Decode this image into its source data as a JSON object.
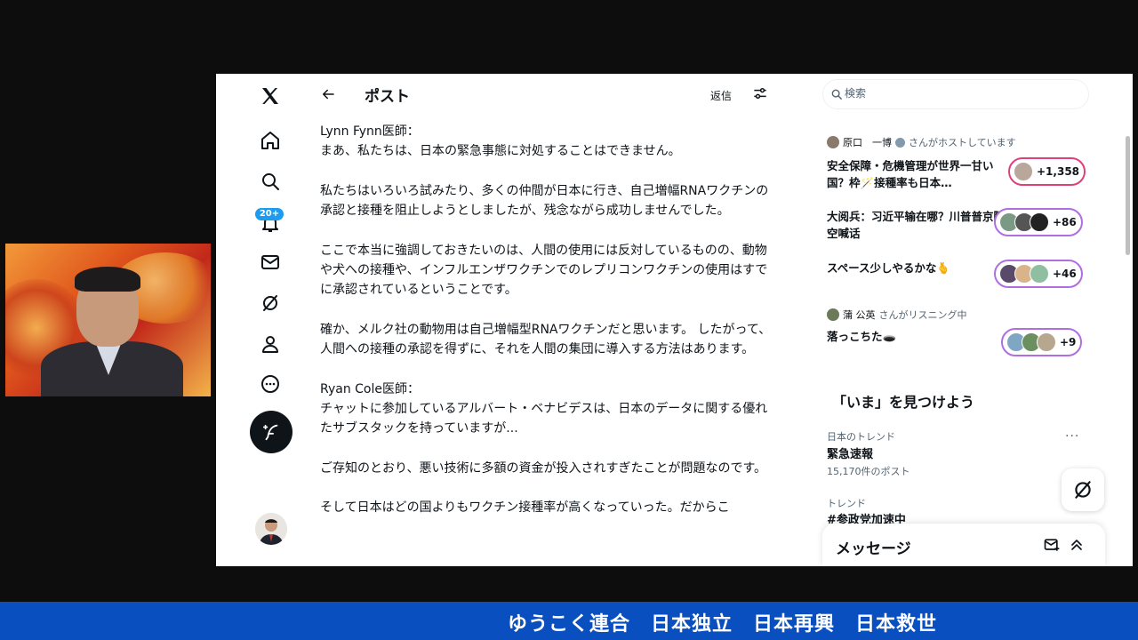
{
  "overlay": {
    "banner_text": "ゆうこく連合　日本独立　日本再興　日本救世"
  },
  "nav": {
    "logo_icon": "x-logo-icon",
    "items": [
      {
        "name": "home",
        "icon": "home-icon"
      },
      {
        "name": "explore",
        "icon": "search-icon"
      },
      {
        "name": "notifications",
        "icon": "bell-icon",
        "badge": "20+"
      },
      {
        "name": "messages",
        "icon": "mail-icon"
      },
      {
        "name": "grok",
        "icon": "grok-icon"
      },
      {
        "name": "profile",
        "icon": "person-icon"
      },
      {
        "name": "more",
        "icon": "more-icon"
      }
    ],
    "compose_icon": "feather-plus-icon"
  },
  "main": {
    "back_icon": "arrow-left-icon",
    "title": "ポスト",
    "reply_label": "返信",
    "filter_icon": "sliders-icon",
    "paragraphs": [
      "Lynn Fynn医師：\nまあ、私たちは、日本の緊急事態に対処することはできません。",
      "私たちはいろいろ試みたり、多くの仲間が日本に行き、自己増幅RNAワクチンの承認と接種を阻止しようとしましたが、残念ながら成功しませんでした。",
      "ここで本当に強調しておきたいのは、人間の使用には反対しているものの、動物や犬への接種や、インフルエンザワクチンでのレプリコンワクチンの使用はすでに承認されているということです。",
      "確か、メルク社の動物用は自己増幅型RNAワクチンだと思います。 したがって、人間への接種の承認を得ずに、それを人間の集団に導入する方法はあります。",
      " Ryan Cole医師：\nチャットに参加しているアルバート・ベナビデスは、日本のデータに関する優れたサブスタックを持っていますが...",
      "ご存知のとおり、悪い技術に多額の資金が投入されすぎたことが問題なのです。",
      "そして日本はどの国よりもワクチン接種率が高くなっていった。だからこ"
    ]
  },
  "right": {
    "search_placeholder": "検索",
    "spaces": [
      {
        "host_name": "原口　一博",
        "host_suffix": "さんがホストしています",
        "title": "安全保障・危機管理が世界一甘い国？枠🪄接種率も日本…",
        "count": "+1,358",
        "ring": "red"
      },
      {
        "title": "大阅兵：习近平输在哪？川普普京隔空喊话",
        "count": "+86",
        "ring": "purple"
      },
      {
        "title": "スペース少しやるかな🫰",
        "count": "+46",
        "ring": "purple"
      },
      {
        "host_name": "蒲 公英",
        "host_suffix": "さんがリスニング中",
        "title": "落っこちた🕳️",
        "count": "+9",
        "ring": "purple"
      }
    ],
    "explore_title": "「いま」を見つけよう",
    "trends": [
      {
        "category": "日本のトレンド",
        "name": "緊急速報",
        "posts": "15,170件のポスト"
      },
      {
        "category": "トレンド",
        "name": "#参政党加速中",
        "posts": ""
      }
    ],
    "more_label": "···",
    "messages_title": "メッセージ",
    "colors": {
      "accent": "#1d9bf0",
      "ring_purple": "#b06ee0",
      "ring_red": "#e0407a",
      "banner": "#0a4fbf"
    }
  }
}
